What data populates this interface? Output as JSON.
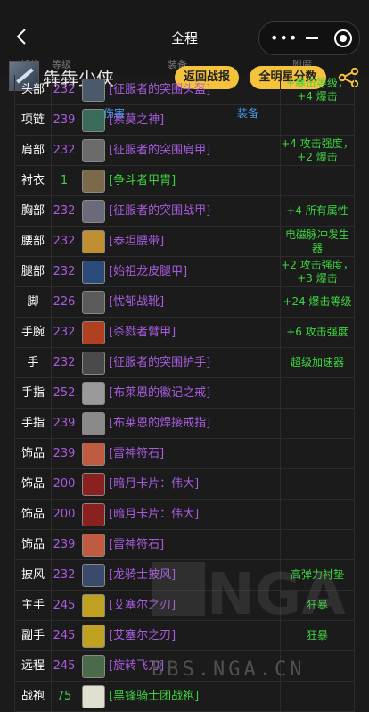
{
  "nav": {
    "title": "全程",
    "back_icon": "chevron-left-icon"
  },
  "header": {
    "player_name": "犇犇少侠",
    "btn_back_report": "返回战报",
    "btn_allstar": "全明星分数",
    "col_slot": "部位",
    "col_level": "等级",
    "col_item": "装备",
    "col_enchant": "附魔"
  },
  "rows": [
    {
      "slot": "头部",
      "level": "232",
      "name": "[征服者的突围头盔]",
      "quality": "purple",
      "enchant": "+暴击等级，+4 爆击",
      "icon": "#4b5a6b"
    },
    {
      "slot": "项链",
      "level": "239",
      "name": "[索莫之神]",
      "quality": "purple",
      "enchant": "",
      "icon": "#3a6b5a"
    },
    {
      "slot": "肩部",
      "level": "232",
      "name": "[征服者的突围肩甲]",
      "quality": "purple",
      "enchant": "+4 攻击强度，+2 爆击",
      "icon": "#6b6b6b"
    },
    {
      "slot": "衬衣",
      "level": "1",
      "name": "[争斗者甲胄]",
      "quality": "green",
      "enchant": "",
      "icon": "#7a6a4a"
    },
    {
      "slot": "胸部",
      "level": "232",
      "name": "[征服者的突围战甲]",
      "quality": "purple",
      "enchant": "+4 所有属性",
      "icon": "#6a6a7a"
    },
    {
      "slot": "腰部",
      "level": "232",
      "name": "[泰坦腰带]",
      "quality": "purple",
      "enchant": "电磁脉冲发生器",
      "icon": "#c09030"
    },
    {
      "slot": "腿部",
      "level": "232",
      "name": "[始祖龙皮腿甲]",
      "quality": "purple",
      "enchant": "+2 攻击强度，+3 爆击",
      "icon": "#2a4a7a"
    },
    {
      "slot": "脚",
      "level": "226",
      "name": "[忧郁战靴]",
      "quality": "purple",
      "enchant": "+24 爆击等级",
      "icon": "#5a5a5a"
    },
    {
      "slot": "手腕",
      "level": "232",
      "name": "[杀戮者臂甲]",
      "quality": "purple",
      "enchant": "+6 攻击强度",
      "icon": "#b04020"
    },
    {
      "slot": "手",
      "level": "232",
      "name": "[征服者的突围护手]",
      "quality": "purple",
      "enchant": "超级加速器",
      "icon": "#4a4a4a"
    },
    {
      "slot": "手指",
      "level": "252",
      "name": "[布莱恩的徽记之戒]",
      "quality": "purple",
      "enchant": "",
      "icon": "#9a9a9a"
    },
    {
      "slot": "手指",
      "level": "239",
      "name": "[布莱恩的焊接戒指]",
      "quality": "purple",
      "enchant": "",
      "icon": "#8a8a8a"
    },
    {
      "slot": "饰品",
      "level": "239",
      "name": "[雷神符石]",
      "quality": "purple",
      "enchant": "",
      "icon": "#c05a40"
    },
    {
      "slot": "饰品",
      "level": "200",
      "name": "[暗月卡片：伟大]",
      "quality": "purple",
      "enchant": "",
      "icon": "#8a2020"
    },
    {
      "slot": "饰品",
      "level": "200",
      "name": "[暗月卡片：伟大]",
      "quality": "purple",
      "enchant": "",
      "icon": "#8a2020"
    },
    {
      "slot": "饰品",
      "level": "239",
      "name": "[雷神符石]",
      "quality": "purple",
      "enchant": "",
      "icon": "#c05a40"
    },
    {
      "slot": "披风",
      "level": "232",
      "name": "[龙骑士披风]",
      "quality": "purple",
      "enchant": "高弹力衬垫",
      "icon": "#3a4a6a"
    },
    {
      "slot": "主手",
      "level": "245",
      "name": "[艾塞尔之刃]",
      "quality": "purple",
      "enchant": "狂暴",
      "icon": "#c0a020"
    },
    {
      "slot": "副手",
      "level": "245",
      "name": "[艾塞尔之刃]",
      "quality": "purple",
      "enchant": "狂暴",
      "icon": "#c0a020"
    },
    {
      "slot": "远程",
      "level": "245",
      "name": "[旋转飞刀]",
      "quality": "purple",
      "enchant": "",
      "icon": "#4a6a4a"
    },
    {
      "slot": "战袍",
      "level": "75",
      "name": "[黑锋骑士团战袍]",
      "quality": "green",
      "enchant": "",
      "icon": "#e0e0d0"
    }
  ],
  "tooltip": {
    "left": "伤害",
    "right": "装备"
  },
  "watermark": {
    "text": "BBS.NGA.CN",
    "logo": "NGA"
  }
}
